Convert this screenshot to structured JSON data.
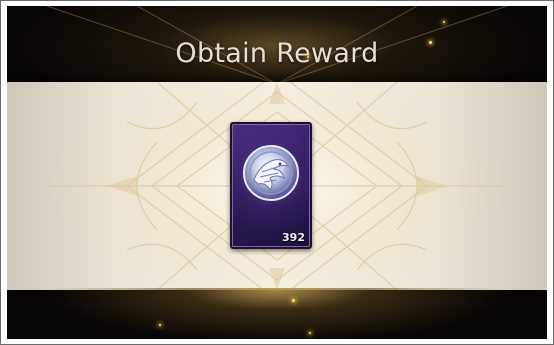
{
  "dialog": {
    "title": "Obtain Reward"
  },
  "reward": {
    "item_icon": "dragon-medallion-icon",
    "count": "392",
    "rarity_color": "#3a2470"
  },
  "theme": {
    "banner_color": "#f3eee2",
    "glow_color": "#c8a45a",
    "title_color": "#e6dfcf"
  }
}
